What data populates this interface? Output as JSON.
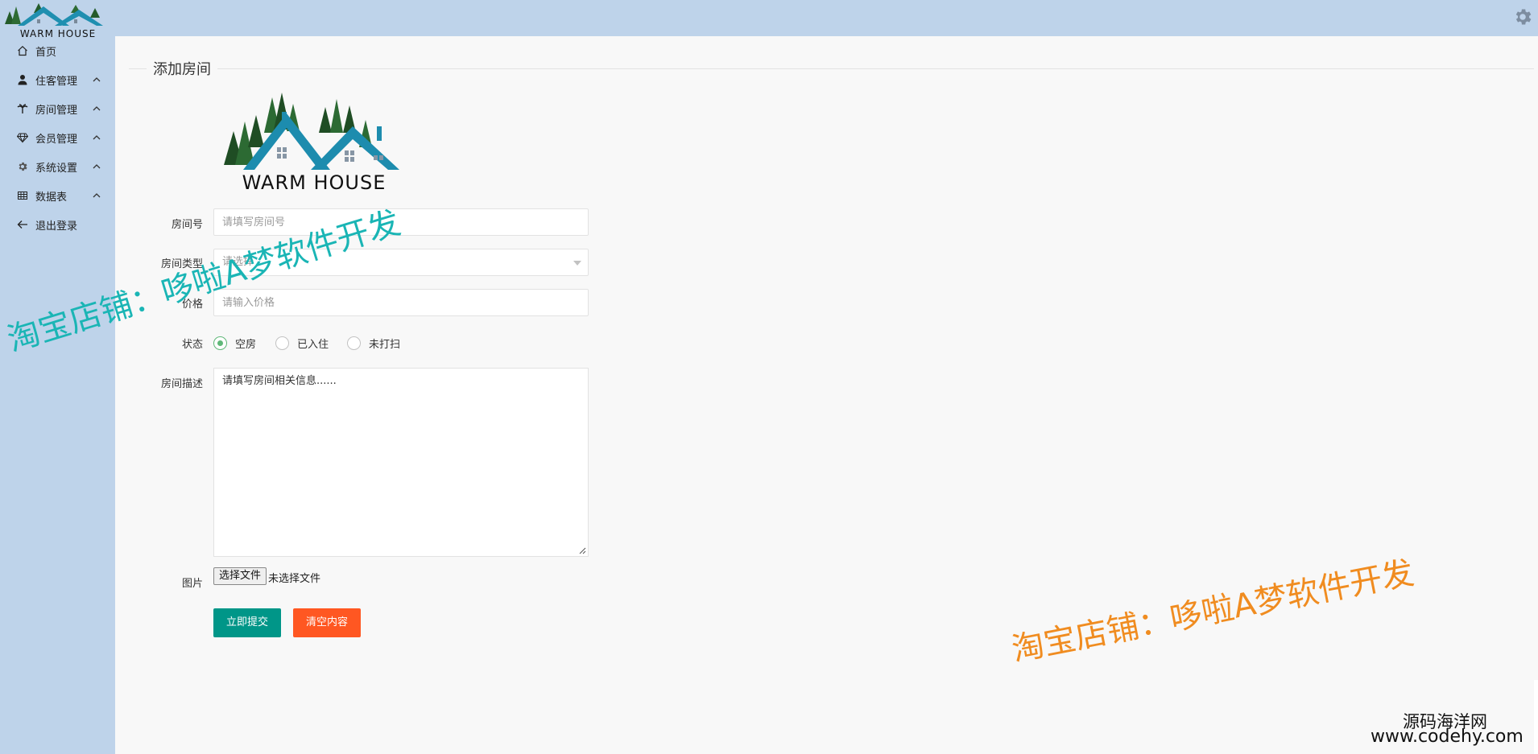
{
  "brand": {
    "logo_text": "WARM HOUSE"
  },
  "sidebar": {
    "items": [
      {
        "label": "首页",
        "icon": "home-icon"
      },
      {
        "label": "住客管理",
        "icon": "user-icon",
        "chevron": "chevron-up-icon"
      },
      {
        "label": "房间管理",
        "icon": "palm-icon",
        "chevron": "chevron-up-icon"
      },
      {
        "label": "会员管理",
        "icon": "diamond-icon",
        "chevron": "chevron-up-icon"
      },
      {
        "label": "系统设置",
        "icon": "gear-icon",
        "chevron": "chevron-up-icon"
      },
      {
        "label": "数据表",
        "icon": "table-icon",
        "chevron": "chevron-up-icon"
      },
      {
        "label": "退出登录",
        "icon": "arrow-left-icon"
      }
    ]
  },
  "header": {
    "settings_icon": "gear-icon"
  },
  "form": {
    "title": "添加房间",
    "logo_text": "WARM HOUSE",
    "room_no": {
      "label": "房间号",
      "placeholder": "请填写房间号"
    },
    "room_type": {
      "label": "房间类型",
      "value": "请选择"
    },
    "price": {
      "label": "价格",
      "placeholder": "请输入价格"
    },
    "status": {
      "label": "状态",
      "options": [
        "空房",
        "已入住",
        "未打扫"
      ],
      "selected": "空房"
    },
    "description": {
      "label": "房间描述",
      "value": "请填写房间相关信息......"
    },
    "image": {
      "label": "图片",
      "button": "选择文件",
      "status": "未选择文件"
    },
    "submit_label": "立即提交",
    "reset_label": "清空内容"
  },
  "watermarks": {
    "teal": "淘宝店铺：哆啦A梦软件开发",
    "orange": "淘宝店铺：哆啦A梦软件开发",
    "site_name": "源码海洋网",
    "site_url": "www.codehy.com"
  },
  "colors": {
    "sidebar_bg": "#bed3ea",
    "primary": "#009688",
    "danger": "#ff5722",
    "radio_checked": "#5fb878",
    "watermark_teal": "#1ab5b5",
    "watermark_orange": "#f08c20"
  }
}
